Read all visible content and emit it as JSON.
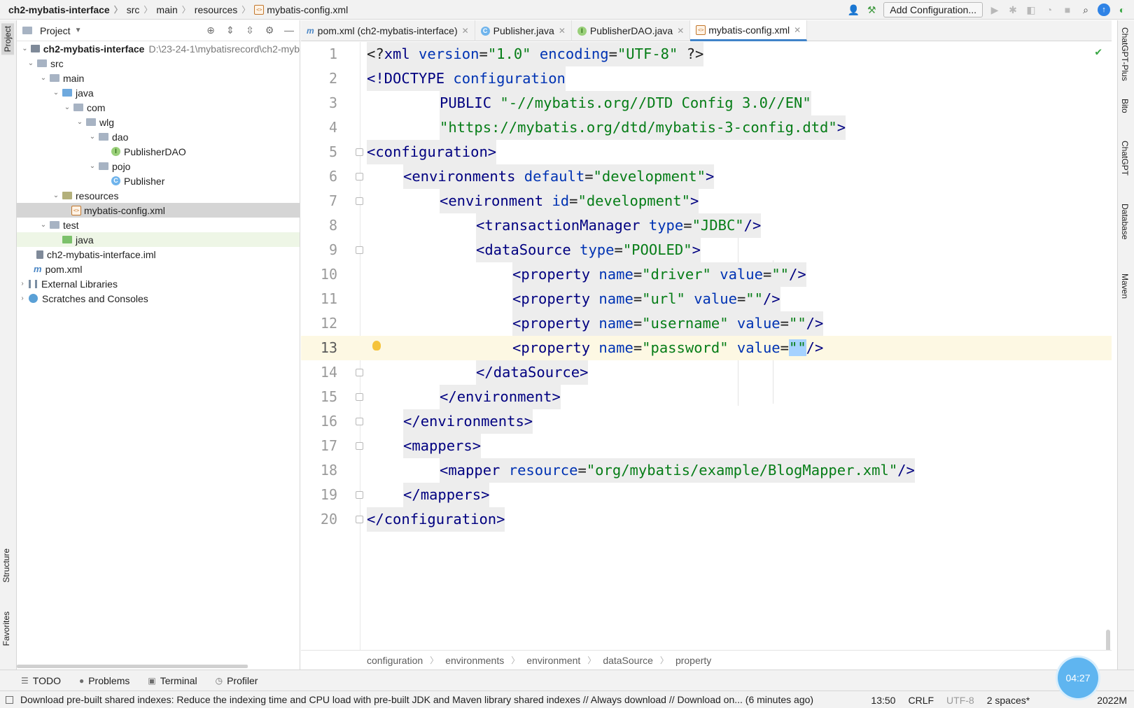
{
  "breadcrumb": {
    "project": "ch2-mybatis-interface",
    "items": [
      "src",
      "main",
      "resources"
    ],
    "file": "mybatis-config.xml"
  },
  "toolbar": {
    "add_configuration": "Add Configuration..."
  },
  "left_strip": {
    "project": "Project",
    "structure": "Structure",
    "favorites": "Favorites"
  },
  "project_panel": {
    "title": "Project",
    "root_name": "ch2-mybatis-interface",
    "root_path": "D:\\23-24-1\\mybatisrecord\\ch2-myb",
    "src": "src",
    "main": "main",
    "java": "java",
    "com": "com",
    "wlg": "wlg",
    "dao": "dao",
    "publisher_dao": "PublisherDAO",
    "pojo": "pojo",
    "publisher": "Publisher",
    "resources": "resources",
    "config_file": "mybatis-config.xml",
    "test": "test",
    "test_java": "java",
    "iml": "ch2-mybatis-interface.iml",
    "pom": "pom.xml",
    "external_libraries": "External Libraries",
    "scratches": "Scratches and Consoles"
  },
  "tabs": [
    {
      "label": "pom.xml (ch2-mybatis-interface)"
    },
    {
      "label": "Publisher.java"
    },
    {
      "label": "PublisherDAO.java"
    },
    {
      "label": "mybatis-config.xml"
    }
  ],
  "code": {
    "line_numbers": [
      "1",
      "2",
      "3",
      "4",
      "5",
      "6",
      "7",
      "8",
      "9",
      "10",
      "11",
      "12",
      "13",
      "14",
      "15",
      "16",
      "17",
      "18",
      "19",
      "20"
    ],
    "l1": {
      "open": "<?",
      "tag": "xml",
      "a1": " version",
      "eq1": "=",
      "v1": "\"1.0\"",
      "a2": " encoding",
      "eq2": "=",
      "v2": "\"UTF-8\"",
      "close": " ?>"
    },
    "l2": {
      "doctype": "<!DOCTYPE",
      "name": " configuration"
    },
    "l3": {
      "public": "PUBLIC",
      "id": "\"-//mybatis.org//DTD Config 3.0//EN\""
    },
    "l4": {
      "url": "\"https://mybatis.org/dtd/mybatis-3-config.dtd\"",
      "close": ">"
    },
    "l5": {
      "lt": "<",
      "tag": "configuration",
      "gt": ">"
    },
    "l6": {
      "lt": "<",
      "tag": "environments",
      "attr": " default",
      "eq": "=",
      "val": "\"development\"",
      "gt": ">"
    },
    "l7": {
      "lt": "<",
      "tag": "environment",
      "attr": " id",
      "eq": "=",
      "val": "\"development\"",
      "gt": ">"
    },
    "l8": {
      "lt": "<",
      "tag": "transactionManager",
      "attr": " type",
      "eq": "=",
      "val": "\"JDBC\"",
      "gt": "/>"
    },
    "l9": {
      "lt": "<",
      "tag": "dataSource",
      "attr": " type",
      "eq": "=",
      "val": "\"POOLED\"",
      "gt": ">"
    },
    "l10": {
      "lt": "<",
      "tag": "property",
      "a1": " name",
      "eq1": "=",
      "v1": "\"driver\"",
      "a2": " value",
      "eq2": "=",
      "v2": "\"\"",
      "gt": "/>"
    },
    "l11": {
      "lt": "<",
      "tag": "property",
      "a1": " name",
      "eq1": "=",
      "v1": "\"url\"",
      "a2": " value",
      "eq2": "=",
      "v2": "\"\"",
      "gt": "/>"
    },
    "l12": {
      "lt": "<",
      "tag": "property",
      "a1": " name",
      "eq1": "=",
      "v1": "\"username\"",
      "a2": " value",
      "eq2": "=",
      "v2": "\"\"",
      "gt": "/>"
    },
    "l13": {
      "lt": "<",
      "tag": "property",
      "a1": " name",
      "eq1": "=",
      "v1": "\"password\"",
      "a2": " value",
      "eq2": "=",
      "v2": "\"\"",
      "gt": "/>"
    },
    "l14": {
      "lt": "</",
      "tag": "dataSource",
      "gt": ">"
    },
    "l15": {
      "lt": "</",
      "tag": "environment",
      "gt": ">"
    },
    "l16": {
      "lt": "</",
      "tag": "environments",
      "gt": ">"
    },
    "l17": {
      "lt": "<",
      "tag": "mappers",
      "gt": ">"
    },
    "l18": {
      "lt": "<",
      "tag": "mapper",
      "attr": " resource",
      "eq": "=",
      "val": "\"org/mybatis/example/BlogMapper.xml\"",
      "gt": "/>"
    },
    "l19": {
      "lt": "</",
      "tag": "mappers",
      "gt": ">"
    },
    "l20": {
      "lt": "</",
      "tag": "configuration",
      "gt": ">"
    }
  },
  "editor_breadcrumb": [
    "configuration",
    "environments",
    "environment",
    "dataSource",
    "property"
  ],
  "right_strip": [
    "ChatGPT-Plus",
    "Bito",
    "ChatGPT",
    "Database",
    "Maven"
  ],
  "bottom_tools": {
    "todo": "TODO",
    "problems": "Problems",
    "terminal": "Terminal",
    "profiler": "Profiler"
  },
  "status_bar": {
    "message": "Download pre-built shared indexes: Reduce the indexing time and CPU load with pre-built JDK and Maven library shared indexes // Always download // Download on... (6 minutes ago)",
    "position": "13:50",
    "line_sep": "CRLF",
    "encoding": "UTF-8",
    "indent": "2 spaces*",
    "memory": "2022M"
  },
  "timer": "04:27",
  "colors": {
    "tag": "#000080",
    "attribute": "#0033b3",
    "string": "#067d17",
    "accent": "#4083c9"
  }
}
